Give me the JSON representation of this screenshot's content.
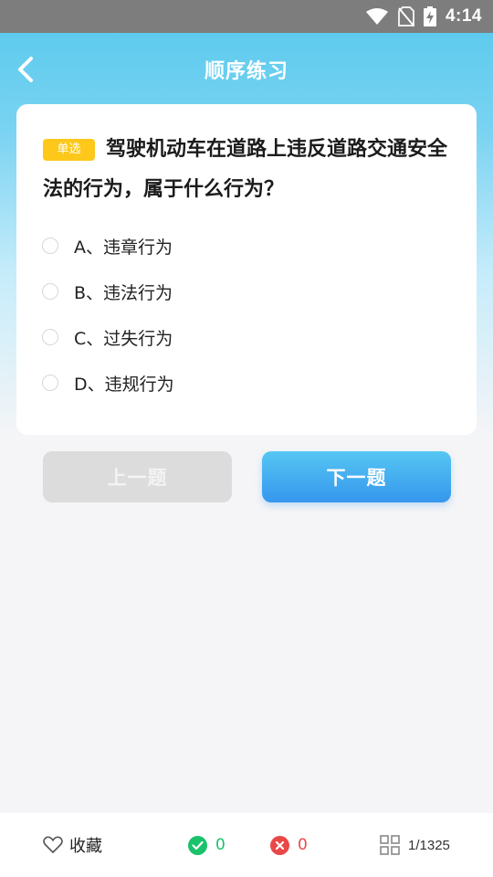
{
  "status_bar": {
    "time": "4:14"
  },
  "header": {
    "title": "顺序练习"
  },
  "question": {
    "type_badge": "单选",
    "text": "驾驶机动车在道路上违反道路交通安全法的行为，属于什么行为？",
    "options": [
      {
        "label": "A、违章行为"
      },
      {
        "label": "B、违法行为"
      },
      {
        "label": "C、过失行为"
      },
      {
        "label": "D、违规行为"
      }
    ]
  },
  "nav": {
    "prev_label": "上一题",
    "next_label": "下一题"
  },
  "bottom_bar": {
    "favorite_label": "收藏",
    "correct_count": "0",
    "wrong_count": "0",
    "progress": "1/1325"
  },
  "colors": {
    "accent": "#3597ee",
    "header_gradient_top": "#55c8ec",
    "badge": "#fdc81a",
    "correct": "#19c26b",
    "wrong": "#e94848"
  },
  "icons": [
    "wifi-icon",
    "no-sim-icon",
    "battery-charging-icon",
    "back-arrow-icon",
    "heart-icon",
    "check-circle-icon",
    "cross-circle-icon",
    "answer-sheet-grid-icon"
  ]
}
